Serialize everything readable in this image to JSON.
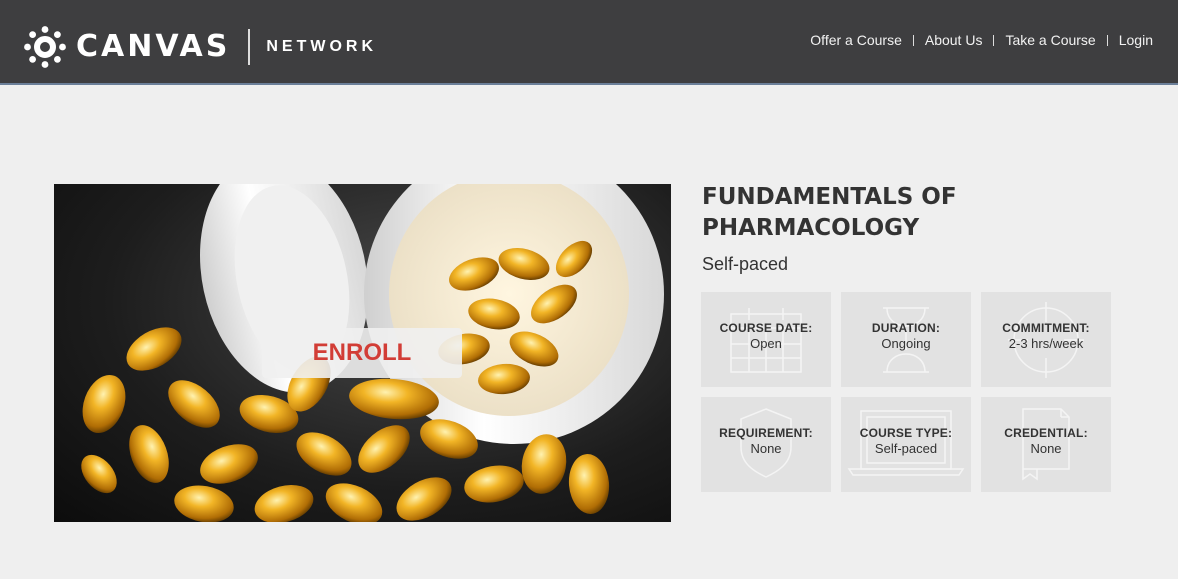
{
  "header": {
    "brand": "CANVAS",
    "sub_brand": "NETWORK",
    "nav": [
      {
        "label": "Offer a Course"
      },
      {
        "label": "About Us"
      },
      {
        "label": "Take a Course"
      },
      {
        "label": "Login"
      }
    ]
  },
  "course": {
    "title": "FUNDAMENTALS OF PHARMACOLOGY",
    "pace": "Self-paced",
    "enroll_label": "ENROLL",
    "details": [
      {
        "label": "COURSE DATE:",
        "value": "Open",
        "icon": "calendar-icon"
      },
      {
        "label": "DURATION:",
        "value": "Ongoing",
        "icon": "hourglass-icon"
      },
      {
        "label": "COMMITMENT:",
        "value": "2-3 hrs/week",
        "icon": "target-icon"
      },
      {
        "label": "REQUIREMENT:",
        "value": "None",
        "icon": "shield-icon"
      },
      {
        "label": "COURSE TYPE:",
        "value": "Self-paced",
        "icon": "laptop-icon"
      },
      {
        "label": "CREDENTIAL:",
        "value": "None",
        "icon": "certificate-icon"
      }
    ]
  },
  "colors": {
    "header_bg": "#3e3e40",
    "page_bg": "#efefef",
    "tile_bg": "#e2e2e2",
    "enroll_text": "#d23d36"
  }
}
